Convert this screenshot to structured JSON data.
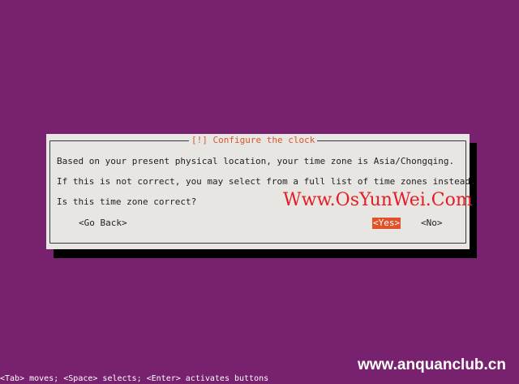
{
  "colors": {
    "background": "#77216F",
    "dialog_background": "#E8E6E3",
    "title_text": "#D15A2F",
    "selected_button_background": "#E0532A",
    "watermark_text": "#E51C23"
  },
  "dialog": {
    "title": "[!] Configure the clock",
    "lines": [
      "Based on your present physical location, your time zone is Asia/Chongqing.",
      "If this is not correct, you may select from a full list of time zones instead.",
      "Is this time zone correct?"
    ],
    "buttons": {
      "go_back": "<Go Back>",
      "yes": "<Yes>",
      "no": "<No>"
    },
    "selected_button": "yes"
  },
  "watermarks": {
    "center": "Www.OsYunWei.Com",
    "bottom_right": "www.anquanclub.cn"
  },
  "help_line": "<Tab> moves; <Space> selects; <Enter> activates buttons"
}
